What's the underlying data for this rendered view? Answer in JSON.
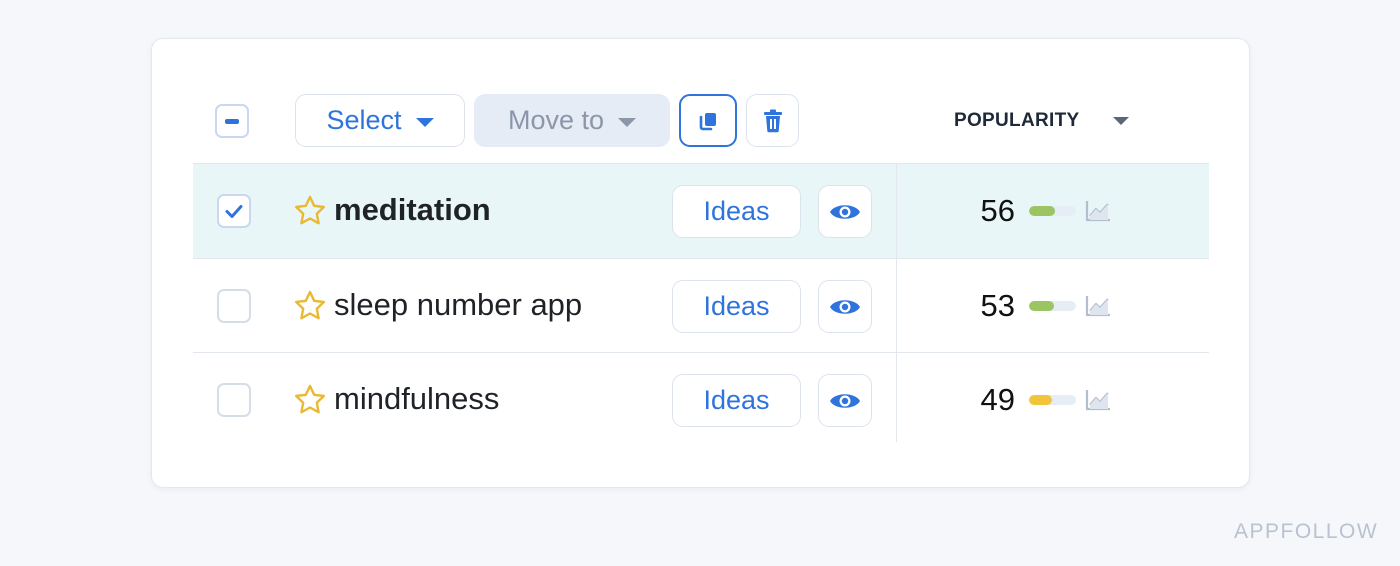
{
  "toolbar": {
    "select_label": "Select",
    "move_label": "Move to",
    "copy_icon": "copy-icon",
    "delete_icon": "trash-icon"
  },
  "columns": {
    "popularity_label": "POPULARITY"
  },
  "rows": [
    {
      "keyword": "meditation",
      "ideas_label": "Ideas",
      "score": "56",
      "bar_fraction": 0.56,
      "bar_color": "#9bc463",
      "selected": true
    },
    {
      "keyword": "sleep number app",
      "ideas_label": "Ideas",
      "score": "53",
      "bar_fraction": 0.53,
      "bar_color": "#9bc463",
      "selected": false
    },
    {
      "keyword": "mindfulness",
      "ideas_label": "Ideas",
      "score": "49",
      "bar_fraction": 0.49,
      "bar_color": "#f2c43a",
      "selected": false
    }
  ],
  "colors": {
    "accent": "#2f74dd",
    "star": "#e8b931",
    "selected_row": "#e8f6f7"
  },
  "watermark": "APPFOLLOW"
}
